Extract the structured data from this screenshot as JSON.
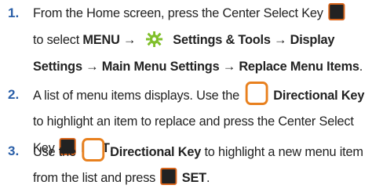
{
  "steps": [
    {
      "number": "1.",
      "l1_a": "From the Home screen, press the Center Select Key",
      "l2_a": "to select ",
      "l2_menu": "MENU",
      "l2_arrow": "→",
      "l2_settings": "Settings & Tools",
      "l2_arrow2": "→",
      "l2_display": "Display",
      "l3_settings": "Settings",
      "l3_arrow": "→",
      "l3_main": "Main Menu Settings",
      "l3_arrow2": "→",
      "l3_replace": "Replace Menu Items",
      "l3_end": "."
    },
    {
      "number": "2.",
      "l1_a": "A list of menu items displays. Use the",
      "l1_dir": "Directional Key",
      "l2": "to highlight an item to replace and press the Center Select",
      "l3_a": "Key",
      "l3_edit": "EDIT",
      "l3_end": "."
    },
    {
      "number": "3.",
      "l1_a": "Use the",
      "l1_dir": "Directional Key",
      "l1_b": "to highlight a new menu item",
      "l2_a": "from the list and press",
      "l2_set": "SET",
      "l2_end": "."
    }
  ],
  "icons": {
    "center_select_key": "center-select-key-icon",
    "directional_key": "directional-key-icon",
    "settings_tools": "settings-tools-gear-icon"
  },
  "colors": {
    "step_number": "#2a5fa8",
    "key_border": "#e8801e",
    "key_fill": "#222222"
  }
}
